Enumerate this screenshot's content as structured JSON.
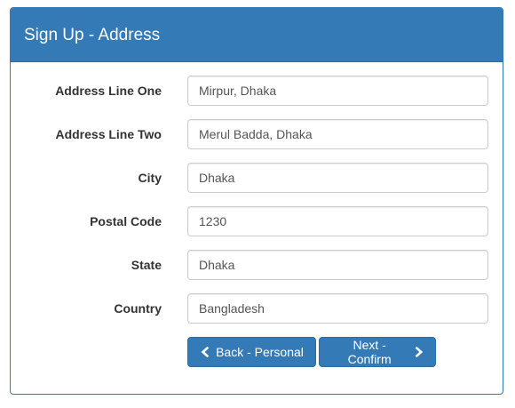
{
  "panel": {
    "title": "Sign Up - Address"
  },
  "fields": [
    {
      "label": "Address Line One",
      "value": "Mirpur, Dhaka"
    },
    {
      "label": "Address Line Two",
      "value": "Merul Badda, Dhaka"
    },
    {
      "label": "City",
      "value": "Dhaka"
    },
    {
      "label": "Postal Code",
      "value": "1230"
    },
    {
      "label": "State",
      "value": "Dhaka"
    },
    {
      "label": "Country",
      "value": "Bangladesh"
    }
  ],
  "buttons": {
    "back_label": "Back - Personal",
    "back_icon": "chevron-left-icon",
    "next_label": "Next - Confirm",
    "next_icon": "chevron-right-icon"
  },
  "colors": {
    "primary": "#337ab7",
    "panel_border": "#2f7ab8"
  }
}
